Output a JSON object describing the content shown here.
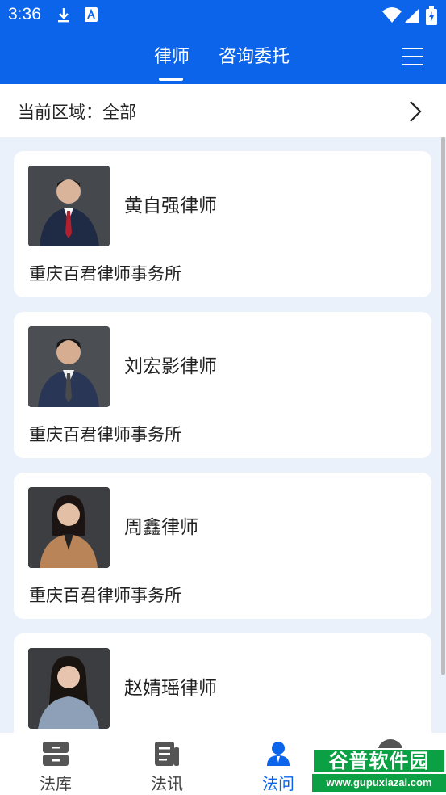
{
  "status_bar": {
    "time": "3:36"
  },
  "header": {
    "tabs": [
      {
        "label": "律师",
        "active": true
      },
      {
        "label": "咨询委托",
        "active": false
      }
    ]
  },
  "region": {
    "label": "当前区域：全部"
  },
  "lawyers": [
    {
      "name": "黄自强律师",
      "firm": "重庆百君律师事务所"
    },
    {
      "name": "刘宏影律师",
      "firm": "重庆百君律师事务所"
    },
    {
      "name": "周鑫律师",
      "firm": "重庆百君律师事务所"
    },
    {
      "name": "赵婧瑶律师",
      "firm": ""
    }
  ],
  "bottom_nav": [
    {
      "label": "法库",
      "icon": "cabinet-icon",
      "active": false
    },
    {
      "label": "法讯",
      "icon": "news-icon",
      "active": false
    },
    {
      "label": "法问",
      "icon": "user-icon",
      "active": true
    }
  ],
  "watermark": {
    "title": "谷普软件园",
    "url": "www.gupuxiazai.com"
  },
  "colors": {
    "primary": "#0b64ea",
    "background": "#eaf1fb",
    "card": "#ffffff",
    "watermark": "#0aa043"
  }
}
